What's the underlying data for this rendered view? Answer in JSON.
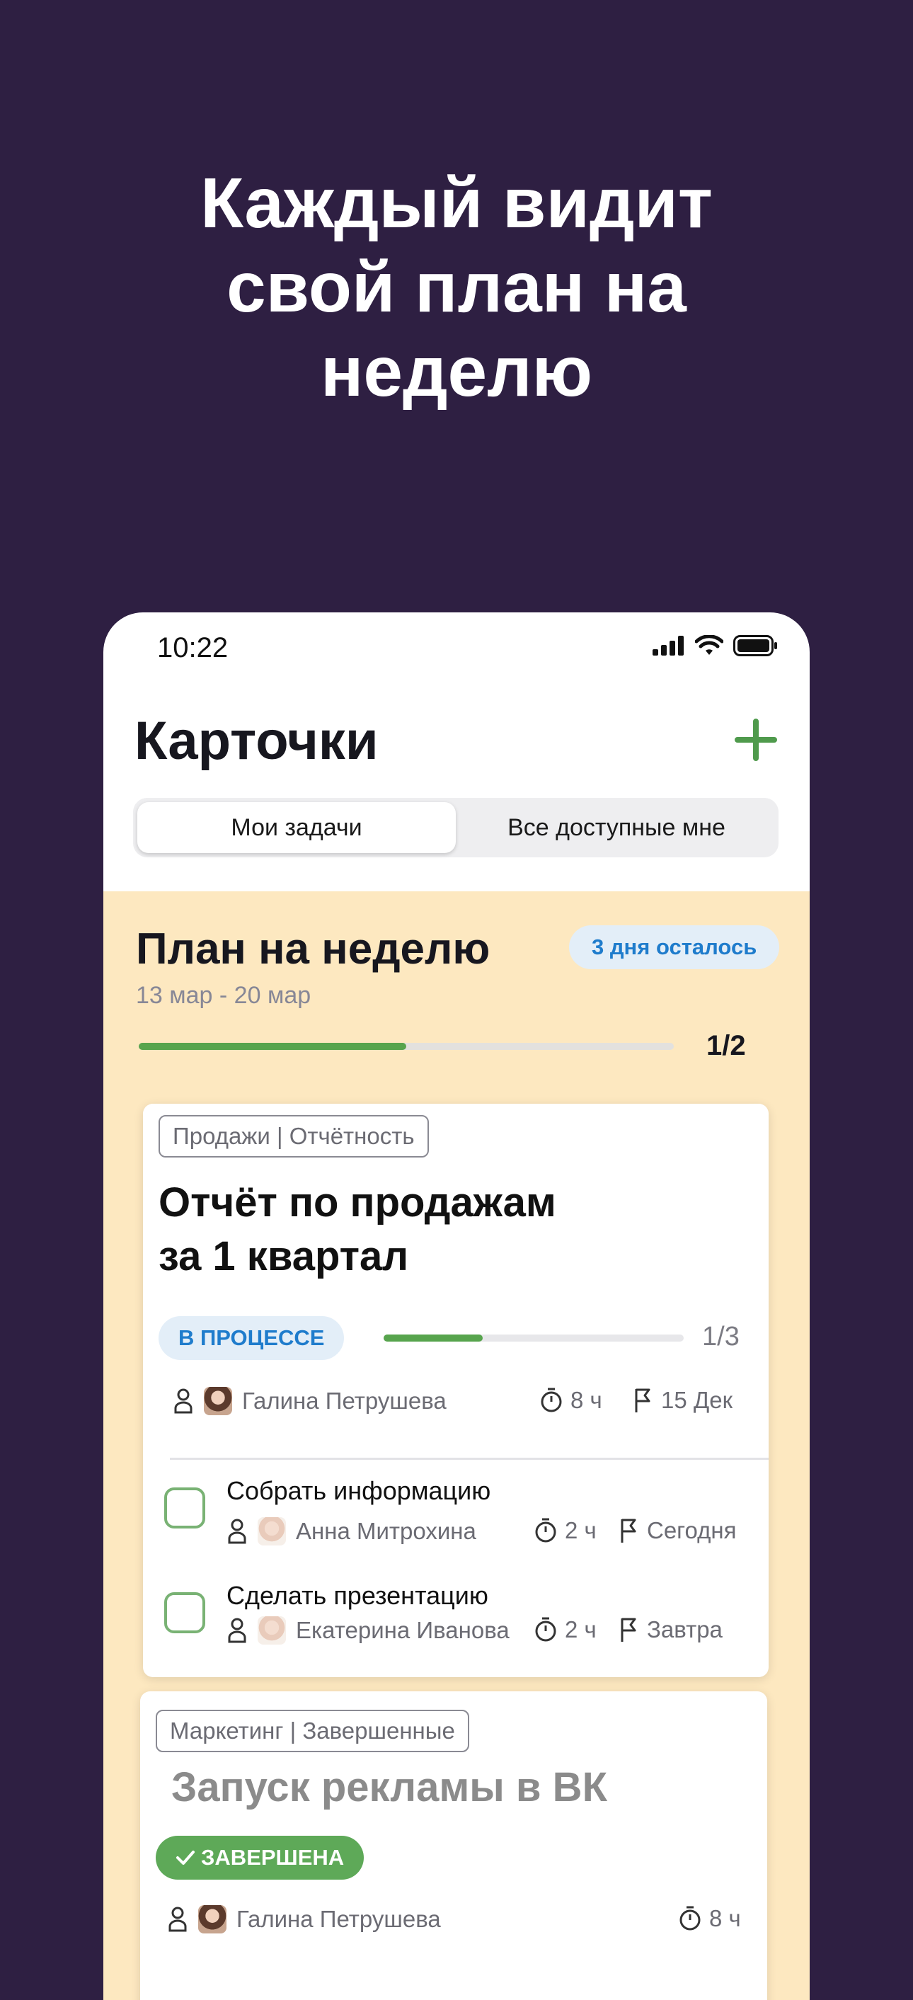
{
  "headline": [
    "Каждый видит",
    "свой план на",
    "неделю"
  ],
  "status_bar": {
    "time": "10:22"
  },
  "app": {
    "title": "Карточки"
  },
  "tabs": [
    {
      "label": "Мои задачи",
      "selected": true
    },
    {
      "label": "Все доступные мне",
      "selected": false
    }
  ],
  "week_plan": {
    "title": "План на неделю",
    "dates": "13 мар - 20 мар",
    "days_left": "3 дня осталось",
    "progress_fraction": 0.5,
    "count": "1/2"
  },
  "cards": [
    {
      "tag": "Продажи | Отчётность",
      "title_lines": [
        "Отчёт по продажам",
        "за 1 квартал"
      ],
      "status": "В ПРОЦЕССЕ",
      "progress_fraction": 0.33,
      "count": "1/3",
      "assignee": "Галина Петрушева",
      "duration": "8 ч",
      "deadline": "15 Дек",
      "subtasks": [
        {
          "title": "Собрать информацию",
          "assignee": "Анна Митрохина",
          "duration": "2 ч",
          "deadline": "Сегодня"
        },
        {
          "title": "Сделать презентацию",
          "assignee": "Екатерина Иванова",
          "duration": "2 ч",
          "deadline": "Завтра"
        }
      ]
    },
    {
      "tag": "Маркетинг | Завершенные",
      "title": "Запуск рекламы в ВК",
      "status": "ЗАВЕРШЕНА",
      "assignee": "Галина Петрушева",
      "duration": "8 ч"
    }
  ],
  "colors": {
    "background": "#2e1f42",
    "accent_green": "#57a44d",
    "accent_blue": "#1f7ccc",
    "panel": "#fde8c0"
  }
}
